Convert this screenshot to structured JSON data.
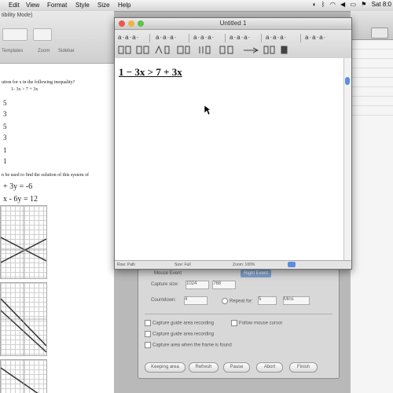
{
  "menubar": {
    "items": [
      "Edit",
      "View",
      "Format",
      "Style",
      "Size",
      "Help"
    ],
    "clock": "Sat 8:0"
  },
  "background_doc": {
    "window_title": "tibility Mode)",
    "toolbar_labels": [
      "Templates",
      "Zoom",
      "Sidebar"
    ],
    "question1": "ution for x in the following inequality?",
    "inequality": "1- 3x > 7 + 3x",
    "choices": [
      "5",
      "3",
      "5",
      "3",
      "1",
      "1"
    ],
    "question2": "n be used to find the solution of this system of",
    "eq1": "+ 3y = -6",
    "eq2": "x - 6y = 12"
  },
  "textedit": {
    "title": "Untitled 1",
    "text_line": "1 − 3x > 7 + 3x",
    "status_left": "Row: Path",
    "status_mid": "Size: Full",
    "status_right": "Zoom: 100%",
    "ruler_groups": [
      "a·a·a·",
      "a·a·a·",
      "a·a·a·",
      "a·a·a·",
      "a·a·a·",
      "a·a·a·"
    ]
  },
  "capture_dialog": {
    "tabs": [
      "Mouse Event",
      "Right Event"
    ],
    "capture_size_label": "Capture size:",
    "capture_size_value": "1024",
    "capture_size_value2": "768",
    "countdown_label": "Countdown:",
    "countdown_value": "4",
    "repeat_label": "Repeat for:",
    "repeat_value": "5",
    "unit_label": "Mins",
    "check1": "Capture guide area recording",
    "check2": "Follow mouse cursor",
    "check3": "Capture guide area recording",
    "check4": "Capture area when the frame is found",
    "buttons": [
      "Keeping area",
      "Refresh",
      "Pause",
      "Abort",
      "Finish"
    ]
  },
  "colors": {
    "close": "#e8584b",
    "minimize": "#f1b53c",
    "zoom": "#5fc24c",
    "selection": "#5b8ee0"
  }
}
